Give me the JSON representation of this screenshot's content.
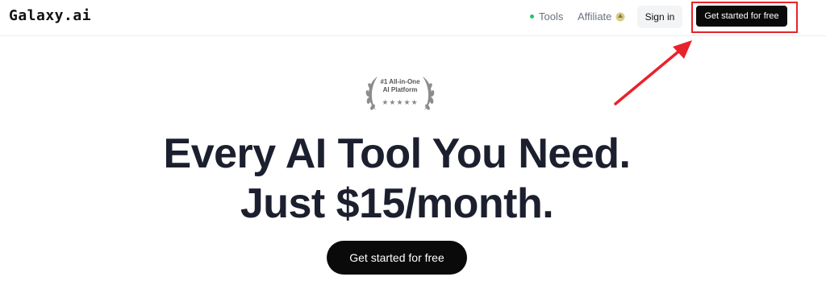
{
  "header": {
    "logo": "Galaxy.ai",
    "tools_label": "Tools",
    "affiliate_label": "Affiliate",
    "signin_label": "Sign in",
    "cta_label": "Get started for free"
  },
  "badge": {
    "line1": "#1 All-in-One",
    "line2": "AI Platform",
    "stars": "★★★★★"
  },
  "hero": {
    "headline_line1": "Every AI Tool You Need.",
    "headline_line2": "Just $15/month.",
    "cta_label": "Get started for free"
  },
  "colors": {
    "accent_annotation": "#e8232b",
    "status_dot": "#22c55e",
    "cta_bg": "#0a0a0a"
  }
}
